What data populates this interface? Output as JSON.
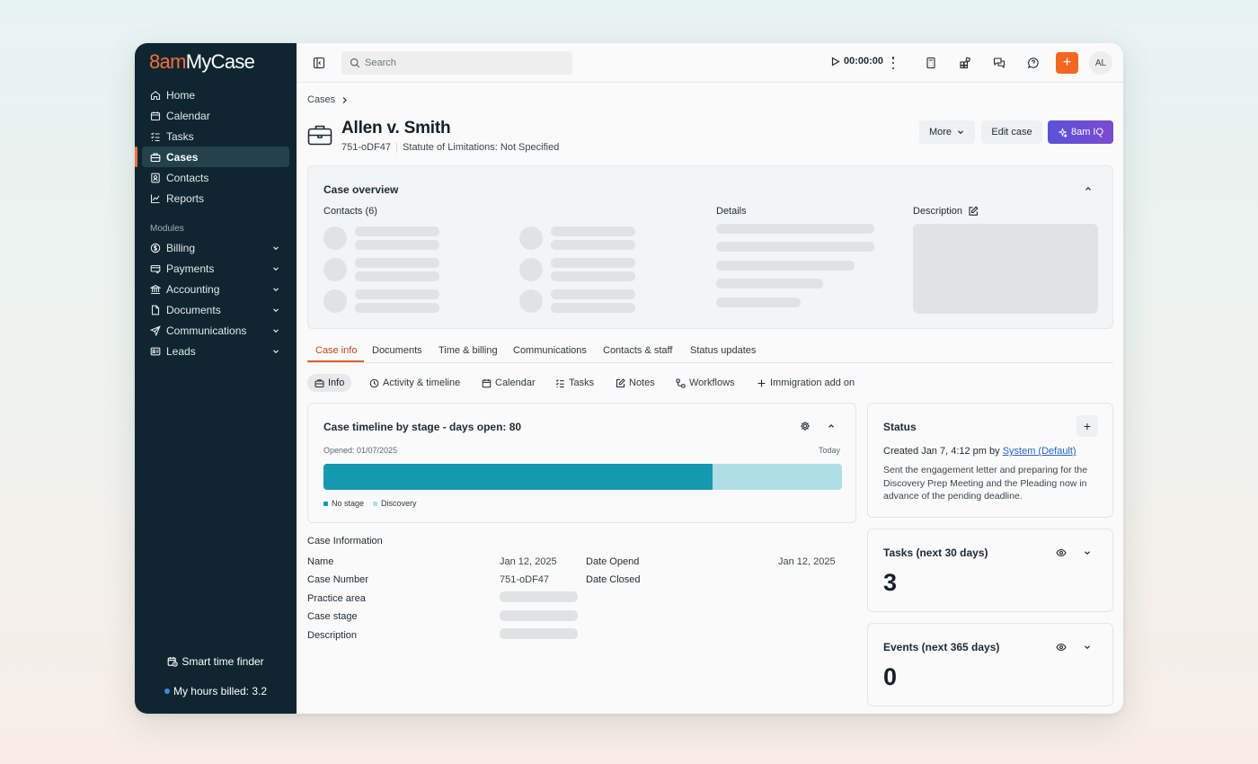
{
  "app": {
    "logo_prefix": "8am",
    "logo_name": "MyCase"
  },
  "sidebar": {
    "items": [
      {
        "label": "Home",
        "icon": "home-icon"
      },
      {
        "label": "Calendar",
        "icon": "calendar-icon"
      },
      {
        "label": "Tasks",
        "icon": "tasks-icon"
      },
      {
        "label": "Cases",
        "icon": "briefcase-icon",
        "active": true
      },
      {
        "label": "Contacts",
        "icon": "contacts-icon"
      },
      {
        "label": "Reports",
        "icon": "chart-icon"
      }
    ],
    "modules_label": "Modules",
    "modules": [
      {
        "label": "Billing",
        "icon": "dollar-icon"
      },
      {
        "label": "Payments",
        "icon": "payments-icon"
      },
      {
        "label": "Accounting",
        "icon": "bank-icon"
      },
      {
        "label": "Documents",
        "icon": "document-icon"
      },
      {
        "label": "Communications",
        "icon": "send-icon"
      },
      {
        "label": "Leads",
        "icon": "leads-icon"
      }
    ],
    "smart_time_finder": "Smart time finder",
    "hours_billed": "My hours billed: 3.2"
  },
  "topbar": {
    "search_placeholder": "Search",
    "timer": "00:00:00",
    "avatar_initials": "AL",
    "add_label": "+"
  },
  "breadcrumb": {
    "root": "Cases"
  },
  "case": {
    "title": "Allen v. Smith",
    "number": "751-oDF47",
    "statute": "Statute of Limitations: Not Specified",
    "more_label": "More",
    "edit_label": "Edit case",
    "iq_label": "8am IQ"
  },
  "overview": {
    "title": "Case overview",
    "contacts_label": "Contacts (6)",
    "details_label": "Details",
    "description_label": "Description"
  },
  "tabs": [
    "Case info",
    "Documents",
    "Time & billing",
    "Communications",
    "Contacts & staff",
    "Status updates"
  ],
  "subtabs": [
    "Info",
    "Activity & timeline",
    "Calendar",
    "Tasks",
    "Notes",
    "Workflows",
    "Immigration add on"
  ],
  "timeline": {
    "title": "Case timeline by stage - days open: 80",
    "opened": "Opened: 01/07/2025",
    "today": "Today",
    "stage_fraction": 0.75,
    "legend": [
      {
        "label": "No stage",
        "color": "#1599b0"
      },
      {
        "label": "Discovery",
        "color": "#afdfe5"
      }
    ]
  },
  "case_info": {
    "title": "Case Information",
    "rows_left": [
      {
        "label": "Name",
        "value": "Jan 12, 2025"
      },
      {
        "label": "Case Number",
        "value": "751-oDF47"
      },
      {
        "label": "Practice area",
        "value": ""
      },
      {
        "label": "Case stage",
        "value": ""
      },
      {
        "label": "Description",
        "value": ""
      }
    ],
    "rows_right": [
      {
        "label": "Date Opend",
        "value": "Jan 12, 2025"
      },
      {
        "label": "Date Closed",
        "value": ""
      }
    ]
  },
  "status": {
    "title": "Status",
    "created_prefix": "Created Jan 7, 4:12 pm by ",
    "created_by": "System (Default)",
    "note": "Sent the engagement letter and preparing for the Discovery Prep Meeting and the Pleading now in advance of the pending deadline."
  },
  "tasks_widget": {
    "title": "Tasks (next 30 days)",
    "count": "3"
  },
  "events_widget": {
    "title": "Events (next 365 days)",
    "count": "0"
  },
  "colors": {
    "accent": "#f26722",
    "sidebar_bg": "#0f2630",
    "iq_gradient": "#5a52d8"
  }
}
